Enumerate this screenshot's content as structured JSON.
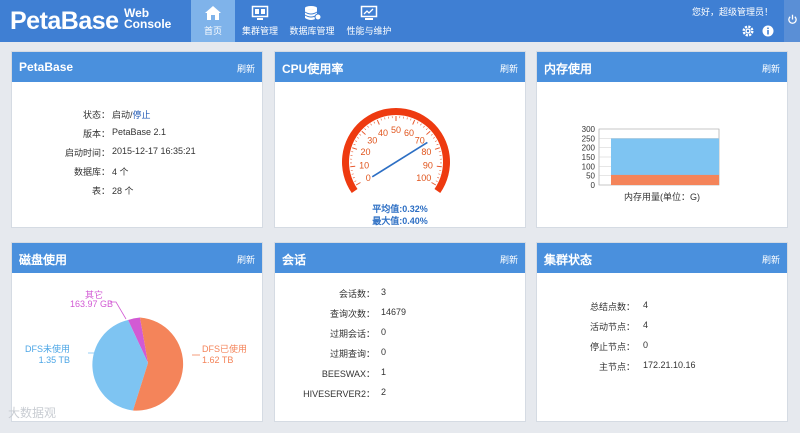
{
  "app": {
    "logo": "PetaBase",
    "logo_sub1": "Web",
    "logo_sub2": "Console"
  },
  "nav": [
    {
      "label": "首页",
      "icon": "home-icon",
      "active": true
    },
    {
      "label": "集群管理",
      "icon": "monitor-icon"
    },
    {
      "label": "数据库管理",
      "icon": "database-icon"
    },
    {
      "label": "性能与维护",
      "icon": "screen-icon"
    }
  ],
  "header": {
    "greeting": "您好，超级管理员！"
  },
  "refresh_label": "刷新",
  "petabase": {
    "title": "PetaBase",
    "status_label": "状态：",
    "status_running": "启动",
    "status_sep": "/",
    "status_stop": "停止",
    "version_label": "版本：",
    "version": "PetaBase 2.1",
    "start_label": "启动时间：",
    "start": "2015-12-17 16:35:21",
    "db_label": "数据库：",
    "db": "4 个",
    "table_label": "表：",
    "table": "28 个"
  },
  "cpu": {
    "title": "CPU使用率",
    "ticks": [
      "0",
      "10",
      "20",
      "30",
      "40",
      "50",
      "60",
      "70",
      "80",
      "90",
      "100"
    ],
    "avg_label": "平均值:0.32%",
    "max_label": "最大值:0.40%",
    "avg_value": 0.32,
    "max_value": 0.4
  },
  "memory": {
    "title": "内存使用",
    "y_ticks": [
      "300",
      "250",
      "200",
      "150",
      "100",
      "50",
      "0"
    ],
    "xlabel": "内存用量(单位：G)",
    "used_fraction": 0.18,
    "total_fraction": 0.83
  },
  "disk": {
    "title": "磁盘使用",
    "slices": [
      {
        "name": "其它",
        "value_label": "163.97 GB",
        "color": "#d25ad4"
      },
      {
        "name": "DFS未使用",
        "value_label": "1.35 TB",
        "color": "#7ec4f2"
      },
      {
        "name": "DFS已使用",
        "value_label": "1.62 TB",
        "color": "#f4845a"
      }
    ]
  },
  "session": {
    "title": "会话",
    "rows": [
      {
        "k": "会话数：",
        "v": "3"
      },
      {
        "k": "查询次数：",
        "v": "14679"
      },
      {
        "k": "过期会话：",
        "v": "0"
      },
      {
        "k": "过期查询：",
        "v": "0"
      },
      {
        "k": "BEESWAX：",
        "v": "1"
      },
      {
        "k": "HIVESERVER2：",
        "v": "2"
      }
    ]
  },
  "cluster": {
    "title": "集群状态",
    "rows": [
      {
        "k": "总结点数：",
        "v": "4"
      },
      {
        "k": "活动节点：",
        "v": "4"
      },
      {
        "k": "停止节点：",
        "v": "0"
      },
      {
        "k": "主节点：",
        "v": "172.21.10.16"
      }
    ]
  },
  "watermark": "大数据观"
}
